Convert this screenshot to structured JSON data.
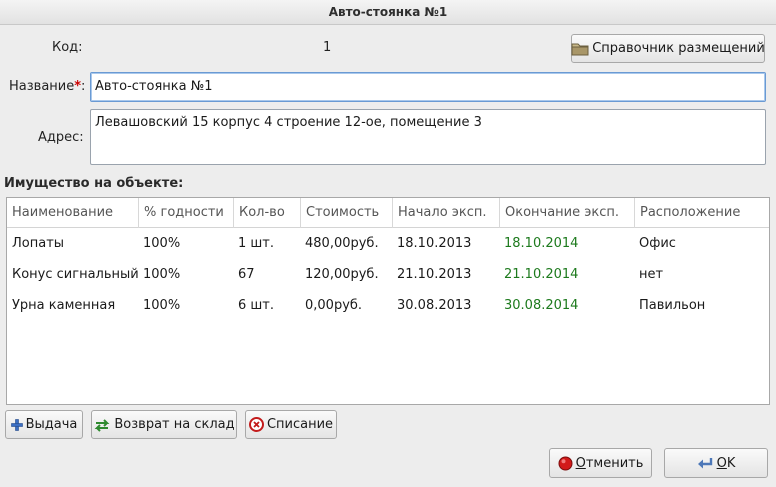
{
  "window": {
    "title": "Авто-стоянка №1"
  },
  "form": {
    "code_label": "Код:",
    "code_value": "1",
    "name_label": "Название",
    "required_mark": "*",
    "name_colon": ":",
    "name_value": "Авто-стоянка №1",
    "address_label": "Адрес:",
    "address_value": "Левашовский 15 корпус 4 строение 12-ое, помещение 3",
    "directory_button": "Справочник размещений"
  },
  "property": {
    "title": "Имущество на объекте:",
    "columns": [
      "Наименование",
      "% годности",
      "Кол-во",
      "Стоимость",
      "Начало эксп.",
      "Окончание эксп.",
      "Расположение"
    ],
    "rows": [
      [
        "Лопаты",
        "100%",
        "1 шт.",
        "480,00руб.",
        "18.10.2013",
        "18.10.2014",
        "Офис"
      ],
      [
        "Конус сигнальный",
        "100%",
        "67",
        "120,00руб.",
        "21.10.2013",
        "21.10.2014",
        "нет"
      ],
      [
        "Урна каменная",
        "100%",
        "6 шт.",
        "0,00руб.",
        "30.08.2013",
        "30.08.2014",
        "Павильон"
      ]
    ]
  },
  "actions": {
    "issue": "Выдача",
    "return": "Возврат на склад",
    "writeoff": "Списание"
  },
  "dialog": {
    "cancel_prefix": "О",
    "cancel_rest": "тменить",
    "ok_prefix": "О",
    "ok_rest": "K"
  },
  "colors": {
    "end_date": "#1d7a1d",
    "required": "#cc0000",
    "focus": "#6a9ad3"
  },
  "icons": {
    "directory": "folder-icon",
    "issue": "plus-icon",
    "return": "return-arrows-icon",
    "writeoff": "delete-circle-icon",
    "cancel": "stop-icon",
    "ok": "enter-arrow-icon"
  }
}
